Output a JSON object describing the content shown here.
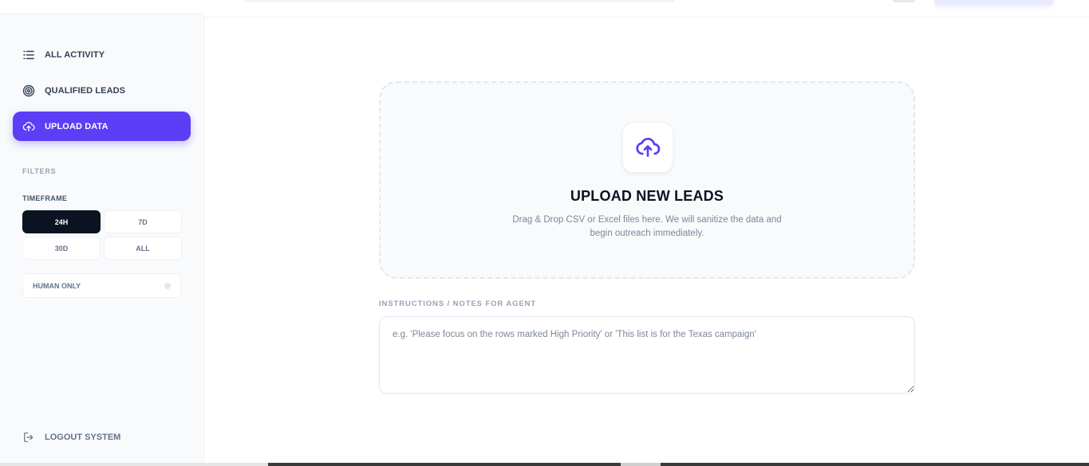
{
  "sidebar": {
    "nav": [
      {
        "label": "ALL ACTIVITY",
        "icon": "list-icon",
        "active": false
      },
      {
        "label": "QUALIFIED LEADS",
        "icon": "target-icon",
        "active": false
      },
      {
        "label": "UPLOAD DATA",
        "icon": "cloud-upload-icon",
        "active": true
      }
    ],
    "filters_title": "FILTERS",
    "timeframe_title": "TIMEFRAME",
    "timeframe_options": [
      {
        "label": "24H",
        "active": true
      },
      {
        "label": "7D",
        "active": false
      },
      {
        "label": "30D",
        "active": false
      },
      {
        "label": "ALL",
        "active": false
      }
    ],
    "human_only_label": "HUMAN ONLY",
    "logout_label": "LOGOUT SYSTEM"
  },
  "dropzone": {
    "title": "UPLOAD NEW LEADS",
    "description": "Drag & Drop CSV or Excel files here. We will sanitize the data and begin outreach immediately."
  },
  "notes": {
    "label": "INSTRUCTIONS / NOTES FOR AGENT",
    "placeholder": "e.g. 'Please focus on the rows marked High Priority' or 'This list is for the Texas campaign'",
    "value": ""
  },
  "colors": {
    "accent": "#5b3ef5",
    "dark": "#0b1220",
    "sidebar_bg": "#f8fafc"
  }
}
